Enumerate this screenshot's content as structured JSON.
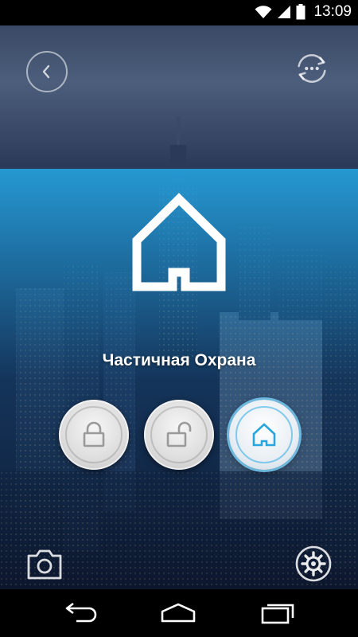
{
  "status_bar": {
    "time": "13:09",
    "icons": [
      "wifi-icon",
      "signal-icon",
      "battery-icon"
    ]
  },
  "header": {
    "back_icon": "chevron-left-icon",
    "sync_icon": "sync-more-icon"
  },
  "main": {
    "current_mode_icon": "home-outline-icon",
    "mode_label": "Частичная Охрана",
    "modes": [
      {
        "name": "arm",
        "icon": "lock-closed-icon",
        "active": false
      },
      {
        "name": "disarm",
        "icon": "lock-open-icon",
        "active": false
      },
      {
        "name": "partial-arm",
        "icon": "home-icon",
        "active": true
      }
    ]
  },
  "footer": {
    "camera_icon": "camera-icon",
    "settings_icon": "gear-icon"
  },
  "nav_bar": {
    "items": [
      "back-icon",
      "home-icon",
      "recents-icon"
    ]
  },
  "colors": {
    "accent": "#2aa6de",
    "active_ring": "#78cdf5",
    "icon_gray": "#9a9a9a"
  }
}
